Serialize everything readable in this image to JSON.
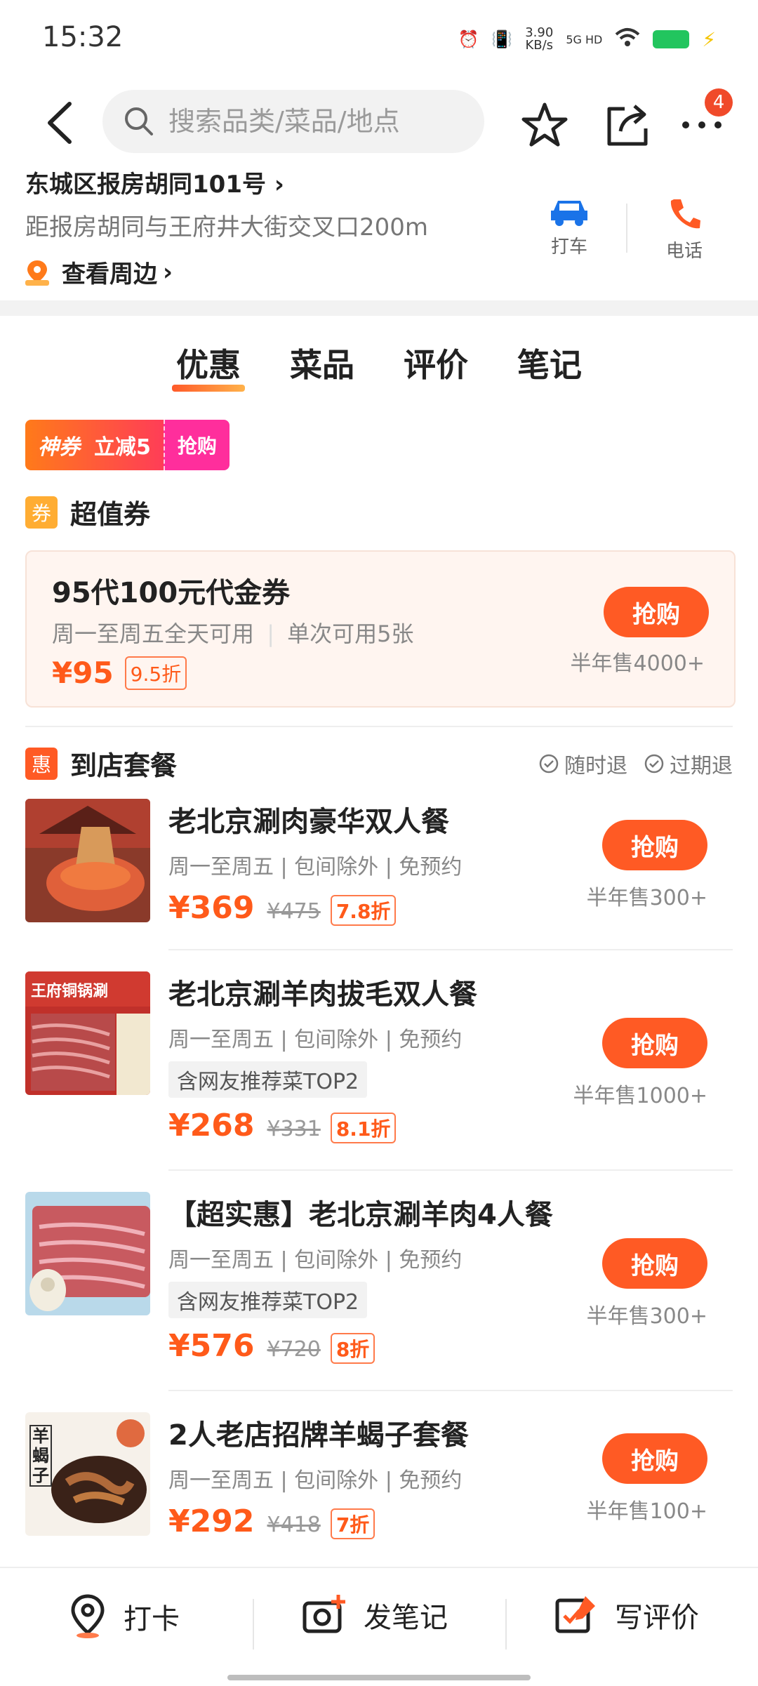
{
  "status_bar": {
    "time": "15:32",
    "net_speed": "3.90\nKB/s",
    "net_type": "5G HD"
  },
  "nav": {
    "search_placeholder": "搜索品类/菜品/地点",
    "more_badge": "4"
  },
  "address": {
    "title": "东城区报房胡同101号",
    "distance": "距报房胡同与王府井大街交叉口200m",
    "nearby": "查看周边"
  },
  "quick_actions": {
    "taxi": "打车",
    "phone": "电话"
  },
  "tabs": [
    "优惠",
    "菜品",
    "评价",
    "笔记"
  ],
  "promo": {
    "tag": "神券",
    "amount": "立减5",
    "buy": "抢购"
  },
  "voucher_section": {
    "icon": "券",
    "title": "超值券",
    "voucher": {
      "title": "95代100元代金券",
      "desc": "周一至周五全天可用",
      "desc2": "单次可用5张",
      "price": "¥95",
      "discount": "9.5折",
      "buy": "抢购",
      "sold": "半年售4000+"
    }
  },
  "package_section": {
    "icon": "惠",
    "title": "到店套餐",
    "refund_any": "随时退",
    "refund_expire": "过期退"
  },
  "deals": [
    {
      "title": "老北京涮肉豪华双人餐",
      "sub": "周一至周五 | 包间除外 | 免预约",
      "tag": "",
      "price": "¥369",
      "orig": "¥475",
      "discount": "7.8折",
      "buy": "抢购",
      "sold": "半年售300+"
    },
    {
      "title": "老北京涮羊肉拔毛双人餐",
      "sub": "周一至周五 | 包间除外 | 免预约",
      "tag": "含网友推荐菜TOP2",
      "price": "¥268",
      "orig": "¥331",
      "discount": "8.1折",
      "buy": "抢购",
      "sold": "半年售1000+"
    },
    {
      "title": "【超实惠】老北京涮羊肉4人餐",
      "sub": "周一至周五 | 包间除外 | 免预约",
      "tag": "含网友推荐菜TOP2",
      "price": "¥576",
      "orig": "¥720",
      "discount": "8折",
      "buy": "抢购",
      "sold": "半年售300+"
    },
    {
      "title": "2人老店招牌羊蝎子套餐",
      "sub": "周一至周五 | 包间除外 | 免预约",
      "tag": "",
      "price": "¥292",
      "orig": "¥418",
      "discount": "7折",
      "buy": "抢购",
      "sold": "半年售100+"
    }
  ],
  "deal_images": {
    "img2_text": "王府铜锅涮",
    "img4_text": "羊蝎子"
  },
  "bottom_bar": {
    "checkin": "打卡",
    "note": "发笔记",
    "review": "写评价"
  },
  "colors": {
    "accent": "#ff5a24",
    "price": "#ff5a1a",
    "promo_pink": "#ff2e9c"
  }
}
